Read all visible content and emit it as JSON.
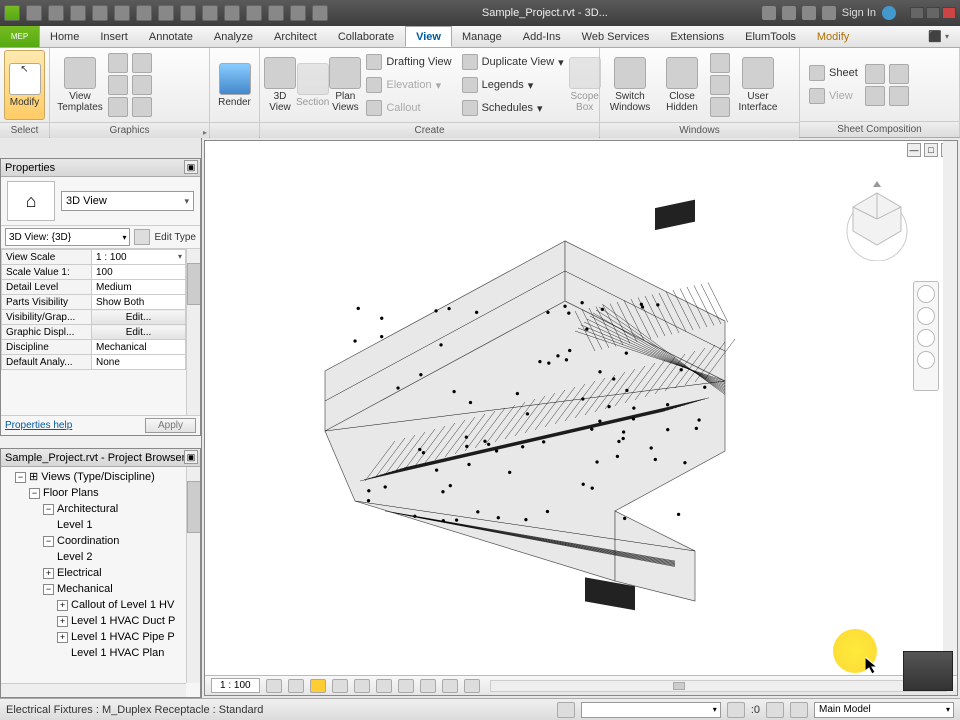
{
  "titlebar": {
    "title": "Sample_Project.rvt - 3D...",
    "signin": "Sign In"
  },
  "menus": {
    "app": "MEP",
    "tabs": [
      "Home",
      "Insert",
      "Annotate",
      "Analyze",
      "Architect",
      "Collaborate",
      "View",
      "Manage",
      "Add-Ins",
      "Web Services",
      "Extensions",
      "ElumTools",
      "Modify"
    ],
    "active": "View"
  },
  "ribbon": {
    "select": {
      "modify": "Modify",
      "label": "Select"
    },
    "graphics": {
      "view_templates": "View\nTemplates",
      "label": "Graphics"
    },
    "render": "Render",
    "view3d": "3D\nView",
    "section": "Section",
    "plan": "Plan\nViews",
    "create": {
      "drafting": "Drafting View",
      "duplicate": "Duplicate View",
      "elevation": "Elevation",
      "legends": "Legends",
      "callout": "Callout",
      "schedules": "Schedules",
      "label": "Create"
    },
    "scope": "Scope\nBox",
    "windows": {
      "switch": "Switch\nWindows",
      "close_hidden": "Close\nHidden",
      "ui": "User\nInterface",
      "label": "Windows"
    },
    "sheetcomp": {
      "sheet": "Sheet",
      "view": "View",
      "label": "Sheet Composition"
    }
  },
  "properties": {
    "title": "Properties",
    "type_name": "3D View",
    "filter": "3D View: {3D}",
    "edit_type": "Edit Type",
    "rows": [
      {
        "name": "View Scale",
        "value": "1 : 100",
        "dropdown": true
      },
      {
        "name": "Scale Value    1:",
        "value": "100"
      },
      {
        "name": "Detail Level",
        "value": "Medium"
      },
      {
        "name": "Parts Visibility",
        "value": "Show Both"
      },
      {
        "name": "Visibility/Grap...",
        "value": "Edit...",
        "button": true
      },
      {
        "name": "Graphic Displ...",
        "value": "Edit...",
        "button": true
      },
      {
        "name": "Discipline",
        "value": "Mechanical"
      },
      {
        "name": "Default Analy...",
        "value": "None"
      }
    ],
    "help": "Properties help",
    "apply": "Apply"
  },
  "browser": {
    "title": "Sample_Project.rvt - Project Browser",
    "root": "Views (Type/Discipline)",
    "floor_plans": "Floor Plans",
    "arch": "Architectural",
    "arch_items": [
      "Level 1"
    ],
    "coord": "Coordination",
    "coord_items": [
      "Level 2"
    ],
    "elec": "Electrical",
    "mech": "Mechanical",
    "mech_items": [
      "Callout of Level 1 HV",
      "Level 1 HVAC Duct P",
      "Level 1 HVAC Pipe P",
      "Level 1 HVAC Plan"
    ]
  },
  "viewbar": {
    "scale": "1 : 100"
  },
  "status": {
    "hint": "Electrical Fixtures : M_Duplex Receptacle : Standard",
    "zero": ":0",
    "workset": "Main Model"
  }
}
